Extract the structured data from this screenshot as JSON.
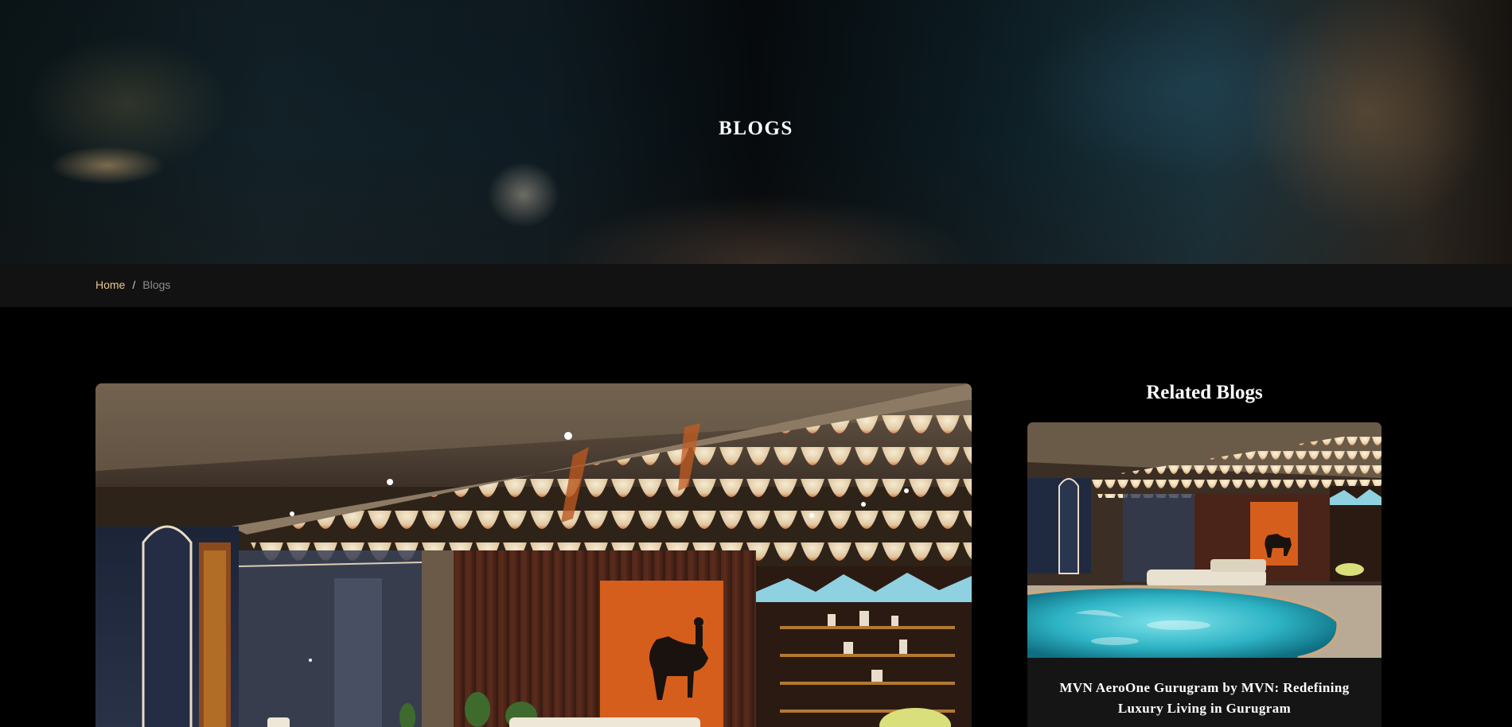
{
  "hero": {
    "title": "BLOGS"
  },
  "breadcrumb": {
    "home": "Home",
    "separator": "/",
    "current": "Blogs"
  },
  "sidebar": {
    "heading": "Related Blogs",
    "cards": [
      {
        "title": "MVN AeroOne Gurugram by MVN: Redefining Luxury Living in Gurugram"
      }
    ]
  },
  "colors": {
    "background": "#000000",
    "breadcrumb_bar": "#121212",
    "breadcrumb_link": "#e6c98e",
    "breadcrumb_current": "#8d8d8d",
    "card_background": "#151515"
  }
}
